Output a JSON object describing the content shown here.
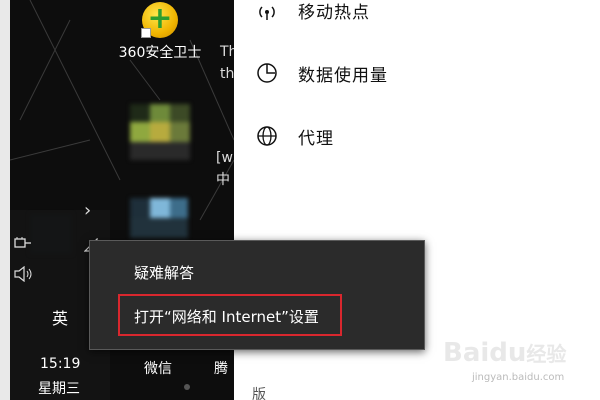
{
  "desktop": {
    "icon_360_label": "360安全卫士",
    "trunc_1a": "Th",
    "trunc_1b": "th",
    "trunc_2a": "[w",
    "trunc_2b": "中",
    "bottom_fragment": "版"
  },
  "taskbar": {
    "ime": "英",
    "time": "15:19",
    "day": "星期三",
    "app_wechat": "微信",
    "app_tencent": "腾"
  },
  "network_panel": {
    "items": [
      {
        "label": "移动热点",
        "icon": "hotspot-icon"
      },
      {
        "label": "数据使用量",
        "icon": "pie-chart-icon"
      },
      {
        "label": "代理",
        "icon": "globe-icon"
      }
    ]
  },
  "context_menu": {
    "items": [
      {
        "label": "疑难解答"
      },
      {
        "label": "打开“网络和 Internet”设置"
      }
    ]
  },
  "watermark": {
    "brand": "Baidu",
    "brand_cn": "经验",
    "url": "jingyan.baidu.com"
  },
  "colors": {
    "highlight_border": "#d9272e",
    "menu_bg": "#2b2b2b",
    "panel_bg": "#ffffff"
  }
}
